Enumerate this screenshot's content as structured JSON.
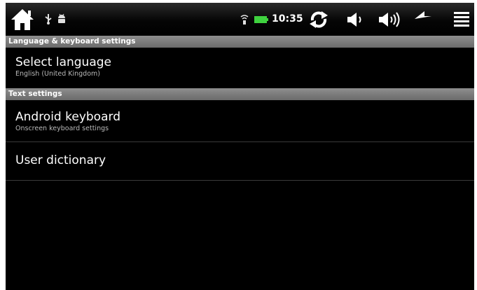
{
  "status_bar": {
    "time": "10:35",
    "icons": {
      "home": "home-icon",
      "usb": "usb-icon",
      "android": "android-debug-icon",
      "wifi": "wifi-signal-icon",
      "battery": "battery-icon",
      "rotate": "rotate-refresh-icon",
      "volume_down": "volume-down-icon",
      "volume_up": "volume-up-icon",
      "back": "back-arrow-icon",
      "menu": "menu-icon"
    },
    "battery_color": "#3fd23f"
  },
  "sections": [
    {
      "header": "Language & keyboard settings",
      "items": [
        {
          "title": "Select language",
          "summary": "English (United Kingdom)"
        }
      ]
    },
    {
      "header": "Text settings",
      "items": [
        {
          "title": "Android keyboard",
          "summary": "Onscreen keyboard settings"
        },
        {
          "title": "User dictionary",
          "summary": ""
        }
      ]
    }
  ],
  "colors": {
    "background": "#000000",
    "section_header": "#7a7a7a",
    "title_text": "#ffffff",
    "summary_text": "#b9b9b9"
  }
}
